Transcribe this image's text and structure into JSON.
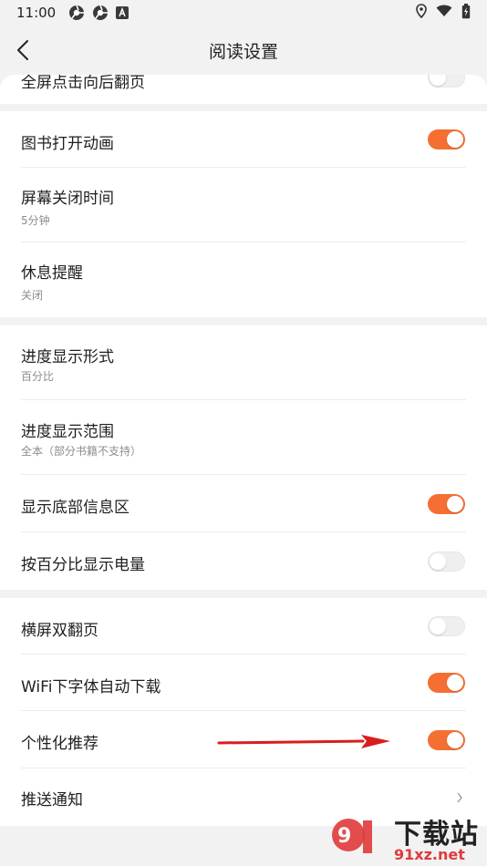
{
  "status_bar": {
    "time": "11:00",
    "icons": [
      "chrome-icon",
      "chrome-icon",
      "app-icon",
      "location-icon",
      "wifi-icon",
      "battery-icon"
    ]
  },
  "nav": {
    "title": "阅读设置",
    "back_icon": "chevron-left-icon"
  },
  "rows": {
    "partial": {
      "label": "全屏点击向后翻页",
      "toggle": false
    },
    "book_open_animation": {
      "label": "图书打开动画",
      "toggle": true
    },
    "screen_off_time": {
      "label": "屏幕关闭时间",
      "value": "5分钟"
    },
    "rest_reminder": {
      "label": "休息提醒",
      "value": "关闭"
    },
    "progress_format": {
      "label": "进度显示形式",
      "value": "百分比"
    },
    "progress_range": {
      "label": "进度显示范围",
      "value": "全本（部分书籍不支持）"
    },
    "bottom_info": {
      "label": "显示底部信息区",
      "toggle": true
    },
    "battery_percent": {
      "label": "按百分比显示电量",
      "toggle": false
    },
    "landscape_double": {
      "label": "横屏双翻页",
      "toggle": false
    },
    "wifi_font_download": {
      "label": "WiFi下字体自动下载",
      "toggle": true
    },
    "personalized_recommend": {
      "label": "个性化推荐",
      "toggle": true
    },
    "push_notification": {
      "label": "推送通知"
    }
  },
  "colors": {
    "accent": "#f56f33",
    "background": "#f2f2f2",
    "arrow": "#d81e1e"
  },
  "watermark": {
    "main_text": "下载站",
    "domain_text": "91xz.net"
  }
}
